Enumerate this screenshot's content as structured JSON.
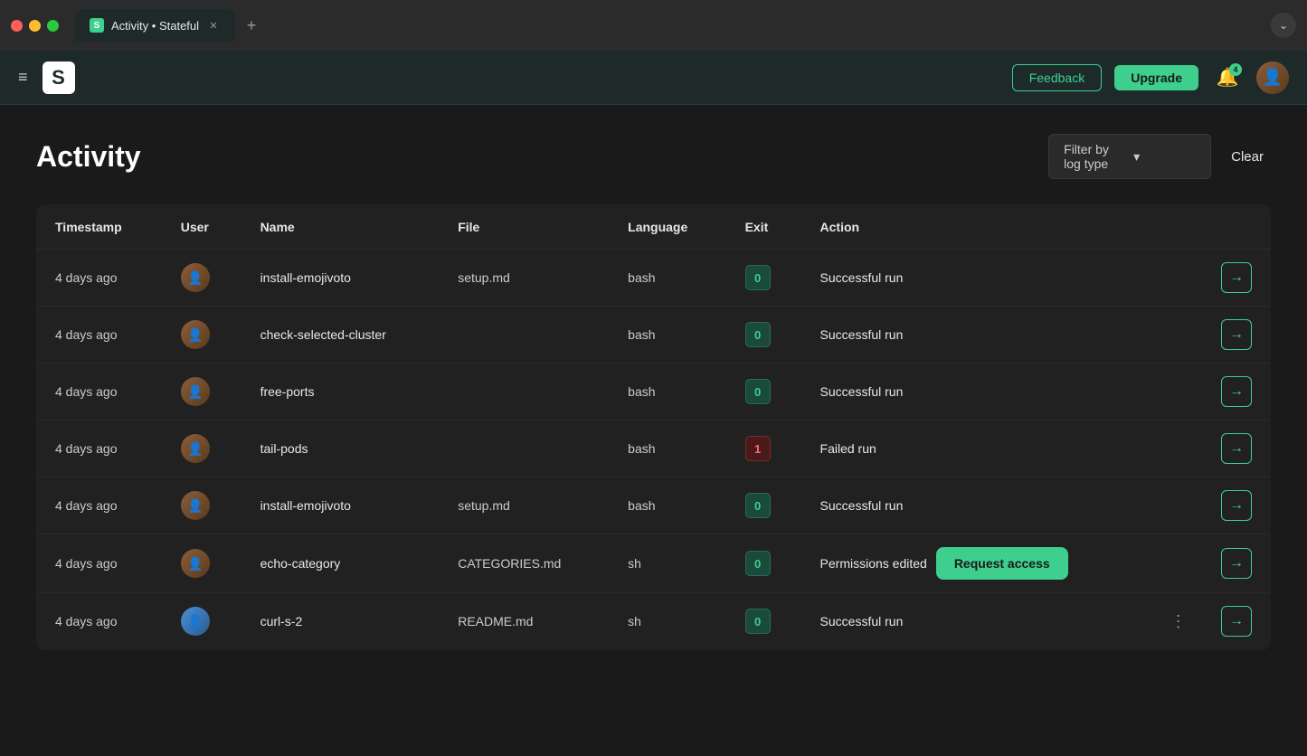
{
  "browser": {
    "tab_label": "Activity • Stateful",
    "tab_icon": "S",
    "new_tab_label": "+",
    "dropdown_arrow": "⌄"
  },
  "header": {
    "menu_icon": "≡",
    "logo_text": "S",
    "feedback_label": "Feedback",
    "upgrade_label": "Upgrade",
    "notification_count": "4",
    "bell_icon": "🔔"
  },
  "page": {
    "title": "Activity",
    "filter_placeholder": "Filter by log type",
    "clear_label": "Clear"
  },
  "table": {
    "columns": [
      "Timestamp",
      "User",
      "Name",
      "File",
      "Language",
      "Exit",
      "Action"
    ],
    "rows": [
      {
        "timestamp": "4 days ago",
        "name": "install-emojivoto",
        "file": "setup.md",
        "language": "bash",
        "exit": "0",
        "exit_status": "success",
        "action": "Successful run"
      },
      {
        "timestamp": "4 days ago",
        "name": "check-selected-cluster",
        "file": "",
        "language": "bash",
        "exit": "0",
        "exit_status": "success",
        "action": "Successful run"
      },
      {
        "timestamp": "4 days ago",
        "name": "free-ports",
        "file": "",
        "language": "bash",
        "exit": "0",
        "exit_status": "success",
        "action": "Successful run"
      },
      {
        "timestamp": "4 days ago",
        "name": "tail-pods",
        "file": "",
        "language": "bash",
        "exit": "1",
        "exit_status": "fail",
        "action": "Failed run"
      },
      {
        "timestamp": "4 days ago",
        "name": "install-emojivoto",
        "file": "setup.md",
        "language": "bash",
        "exit": "0",
        "exit_status": "success",
        "action": "Successful run"
      },
      {
        "timestamp": "4 days ago",
        "name": "echo-category",
        "file": "CATEGORIES.md",
        "language": "sh",
        "exit": "0",
        "exit_status": "success",
        "action": "Permissions edited"
      },
      {
        "timestamp": "4 days ago",
        "name": "curl-s-2",
        "file": "README.md",
        "language": "sh",
        "exit": "0",
        "exit_status": "success",
        "action": "Successful run"
      }
    ]
  },
  "popup": {
    "request_access_label": "Request access"
  }
}
